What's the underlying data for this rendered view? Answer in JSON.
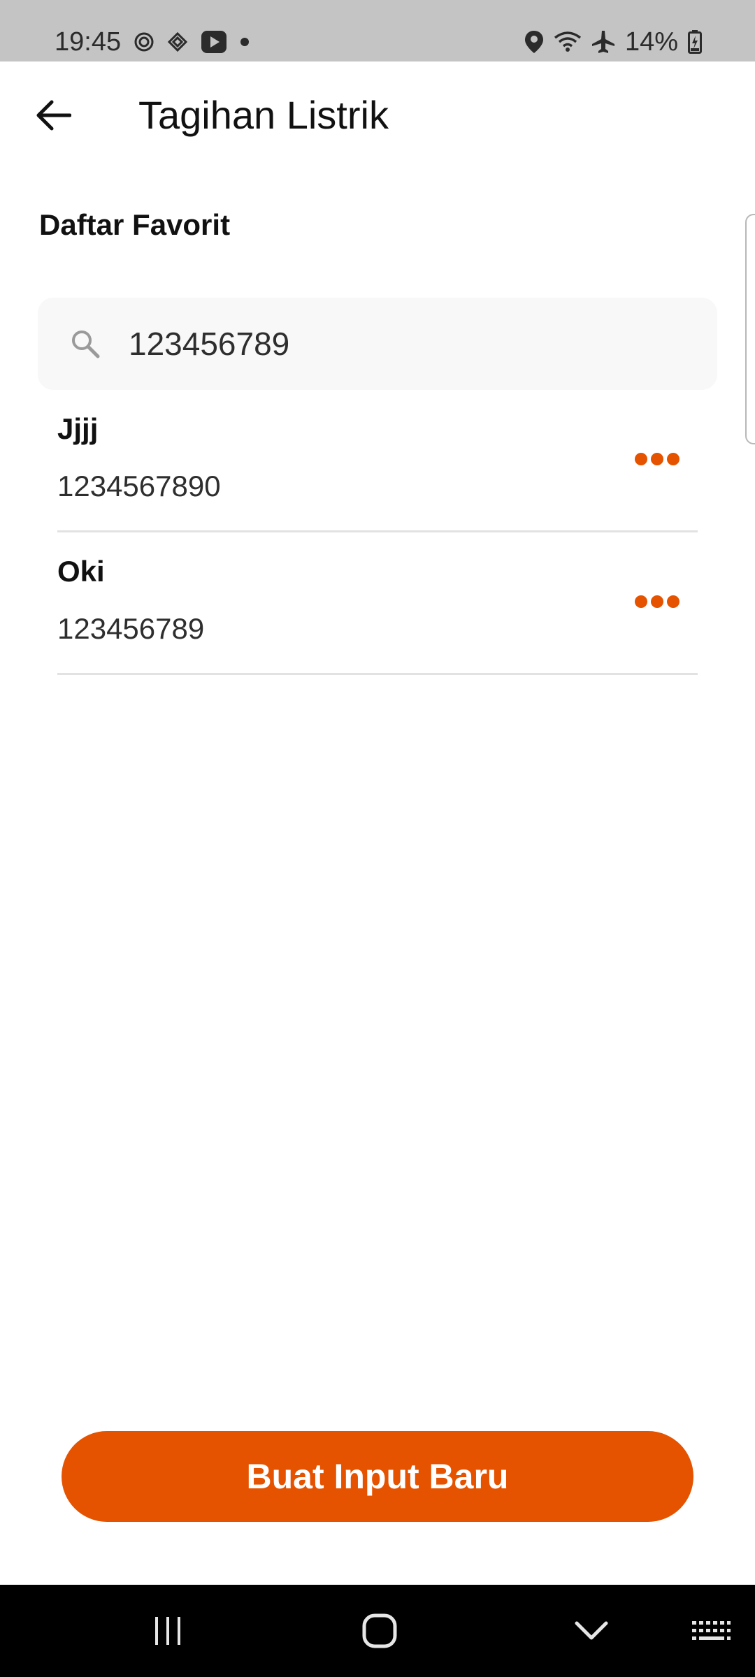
{
  "status_bar": {
    "time": "19:45",
    "battery": "14%",
    "icons": [
      "settings-badge-icon",
      "sync-icon",
      "play-store-icon",
      "notification-dot-icon",
      "location-icon",
      "wifi-icon",
      "airplane-mode-icon",
      "battery-icon"
    ]
  },
  "header": {
    "title": "Tagihan Listrik",
    "back_icon": "arrow-left-icon"
  },
  "section": {
    "title": "Daftar Favorit"
  },
  "search": {
    "value": "123456789",
    "icon": "search-icon"
  },
  "favorites": [
    {
      "name": "Jjjj",
      "number": "1234567890",
      "action_icon": "more-horizontal-icon"
    },
    {
      "name": "Oki",
      "number": "123456789",
      "action_icon": "more-horizontal-icon"
    }
  ],
  "primary_button": {
    "label": "Buat Input Baru"
  },
  "navigation_bar": {
    "buttons": [
      "recent-apps-icon",
      "home-icon",
      "back-chevron-icon",
      "keyboard-icon"
    ]
  },
  "colors": {
    "accent": "#e55300",
    "status_bar": "#c4c4c4",
    "nav_bar": "#000000",
    "search_bg": "#f8f8f8",
    "divider": "#e2e2e2"
  }
}
